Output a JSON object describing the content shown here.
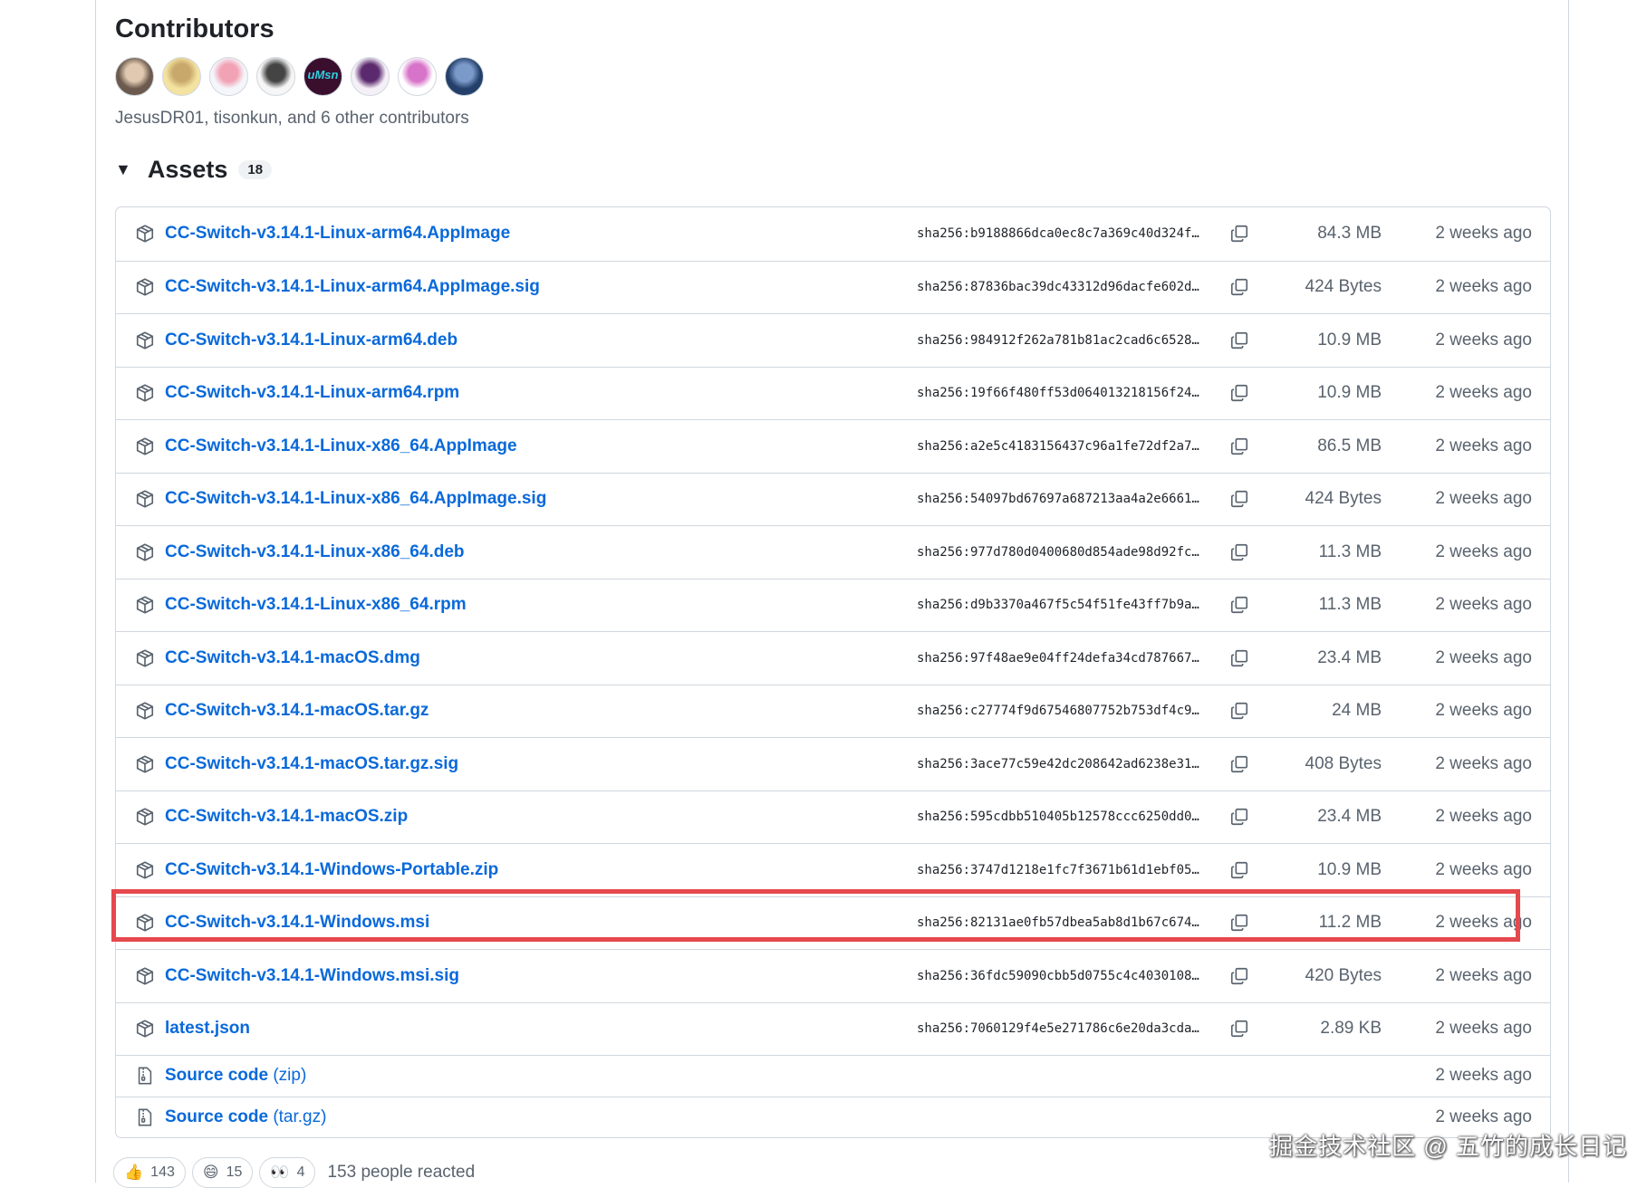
{
  "contributors": {
    "title": "Contributors",
    "summary": "JesusDR01, tisonkun, and 6 other contributors",
    "avatars": [
      {
        "colors": [
          "#6b5a4d",
          "#e0c9b0"
        ]
      },
      {
        "colors": [
          "#f3e2a0",
          "#c9a96b"
        ]
      },
      {
        "colors": [
          "#f4f6fb",
          "#f2a2b5"
        ]
      },
      {
        "colors": [
          "#f6f6f6",
          "#444444"
        ]
      },
      {
        "colors": [
          "#3a0f2e",
          "#2fd0e0"
        ],
        "text": "uMsn"
      },
      {
        "colors": [
          "#f5f0f7",
          "#5b2a6e"
        ]
      },
      {
        "colors": [
          "#ffffff",
          "#d773c9"
        ]
      },
      {
        "colors": [
          "#24406a",
          "#7b99c9"
        ]
      }
    ]
  },
  "assets": {
    "title": "Assets",
    "count": "18",
    "items": [
      {
        "name": "CC-Switch-v3.14.1-Linux-arm64.AppImage",
        "sha": "sha256:b9188866dca0ec8c7a369c40d324f…",
        "size": "84.3 MB",
        "date": "2 weeks ago"
      },
      {
        "name": "CC-Switch-v3.14.1-Linux-arm64.AppImage.sig",
        "sha": "sha256:87836bac39dc43312d96dacfe602d…",
        "size": "424 Bytes",
        "date": "2 weeks ago"
      },
      {
        "name": "CC-Switch-v3.14.1-Linux-arm64.deb",
        "sha": "sha256:984912f262a781b81ac2cad6c6528…",
        "size": "10.9 MB",
        "date": "2 weeks ago"
      },
      {
        "name": "CC-Switch-v3.14.1-Linux-arm64.rpm",
        "sha": "sha256:19f66f480ff53d064013218156f24…",
        "size": "10.9 MB",
        "date": "2 weeks ago"
      },
      {
        "name": "CC-Switch-v3.14.1-Linux-x86_64.AppImage",
        "sha": "sha256:a2e5c4183156437c96a1fe72df2a7…",
        "size": "86.5 MB",
        "date": "2 weeks ago"
      },
      {
        "name": "CC-Switch-v3.14.1-Linux-x86_64.AppImage.sig",
        "sha": "sha256:54097bd67697a687213aa4a2e6661…",
        "size": "424 Bytes",
        "date": "2 weeks ago"
      },
      {
        "name": "CC-Switch-v3.14.1-Linux-x86_64.deb",
        "sha": "sha256:977d780d0400680d854ade98d92fc…",
        "size": "11.3 MB",
        "date": "2 weeks ago"
      },
      {
        "name": "CC-Switch-v3.14.1-Linux-x86_64.rpm",
        "sha": "sha256:d9b3370a467f5c54f51fe43ff7b9a…",
        "size": "11.3 MB",
        "date": "2 weeks ago"
      },
      {
        "name": "CC-Switch-v3.14.1-macOS.dmg",
        "sha": "sha256:97f48ae9e04ff24defa34cd787667…",
        "size": "23.4 MB",
        "date": "2 weeks ago"
      },
      {
        "name": "CC-Switch-v3.14.1-macOS.tar.gz",
        "sha": "sha256:c27774f9d67546807752b753df4c9…",
        "size": "24 MB",
        "date": "2 weeks ago"
      },
      {
        "name": "CC-Switch-v3.14.1-macOS.tar.gz.sig",
        "sha": "sha256:3ace77c59e42dc208642ad6238e31…",
        "size": "408 Bytes",
        "date": "2 weeks ago"
      },
      {
        "name": "CC-Switch-v3.14.1-macOS.zip",
        "sha": "sha256:595cdbb510405b12578ccc6250dd0…",
        "size": "23.4 MB",
        "date": "2 weeks ago"
      },
      {
        "name": "CC-Switch-v3.14.1-Windows-Portable.zip",
        "sha": "sha256:3747d1218e1fc7f3671b61d1ebf05…",
        "size": "10.9 MB",
        "date": "2 weeks ago"
      },
      {
        "name": "CC-Switch-v3.14.1-Windows.msi",
        "sha": "sha256:82131ae0fb57dbea5ab8d1b67c674…",
        "size": "11.2 MB",
        "date": "2 weeks ago"
      },
      {
        "name": "CC-Switch-v3.14.1-Windows.msi.sig",
        "sha": "sha256:36fdc59090cbb5d0755c4c4030108…",
        "size": "420 Bytes",
        "date": "2 weeks ago"
      },
      {
        "name": "latest.json",
        "sha": "sha256:7060129f4e5e271786c6e20da3cda…",
        "size": "2.89 KB",
        "date": "2 weeks ago"
      }
    ],
    "source": [
      {
        "name": "Source code",
        "format": "(zip)",
        "date": "2 weeks ago"
      },
      {
        "name": "Source code",
        "format": "(tar.gz)",
        "date": "2 weeks ago"
      }
    ]
  },
  "reactions": {
    "items": [
      {
        "icon": "thumbs-up-icon",
        "emoji": "👍",
        "count": "143"
      },
      {
        "icon": "laugh-icon",
        "emoji": "😄",
        "count": "15"
      },
      {
        "icon": "eyes-icon",
        "emoji": "👀",
        "count": "4"
      }
    ],
    "summary": "153 people reacted"
  },
  "watermark": "掘金技术社区 @ 五竹的成长日记",
  "colors": {
    "link": "#0969da",
    "muted": "#59636e",
    "highlight": "#e5484d",
    "border": "#d0d7de"
  }
}
